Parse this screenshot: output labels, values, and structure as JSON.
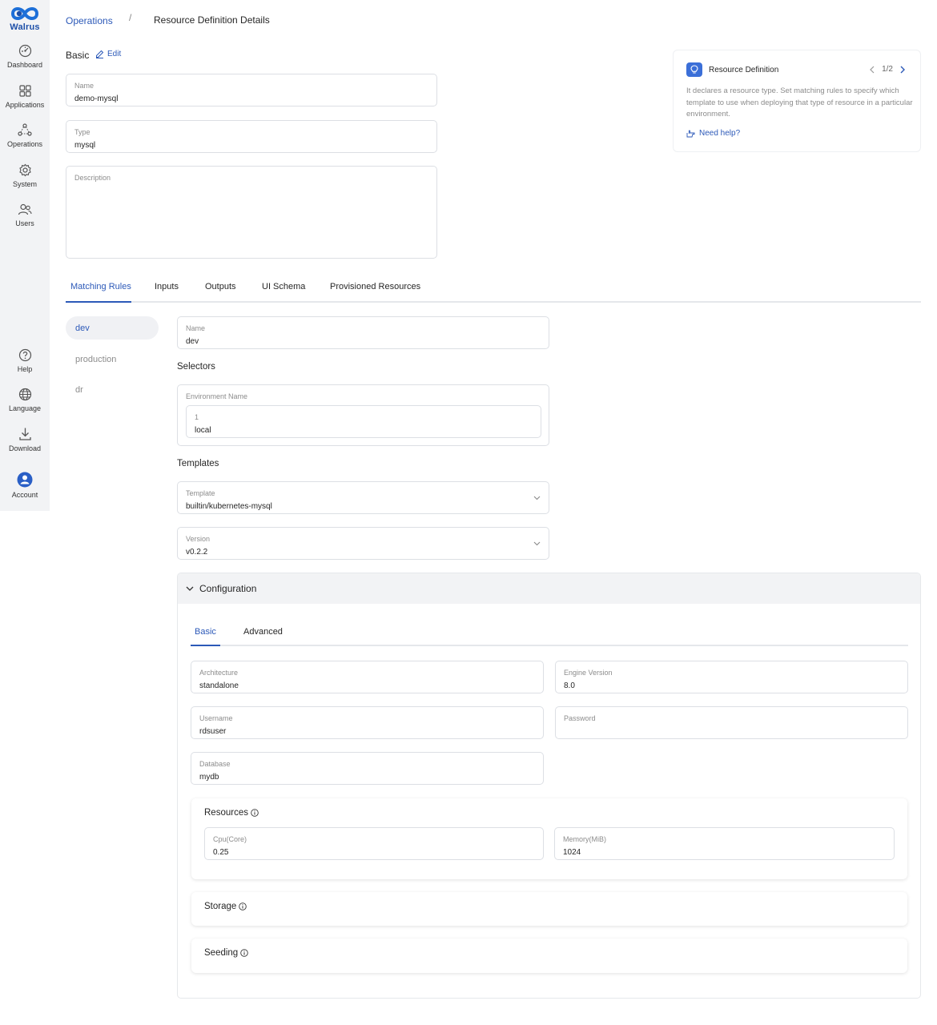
{
  "app": {
    "logo_text": "Walrus"
  },
  "sidebar": {
    "items": [
      {
        "label": "Dashboard",
        "icon": "dashboard-icon"
      },
      {
        "label": "Applications",
        "icon": "grid-icon"
      },
      {
        "label": "Operations",
        "icon": "operations-icon"
      },
      {
        "label": "System",
        "icon": "gear-icon"
      },
      {
        "label": "Users",
        "icon": "users-icon"
      }
    ],
    "bottom_items": [
      {
        "label": "Help",
        "icon": "help-icon"
      },
      {
        "label": "Language",
        "icon": "globe-icon"
      },
      {
        "label": "Download",
        "icon": "download-icon"
      },
      {
        "label": "Account",
        "icon": "account-icon"
      }
    ]
  },
  "breadcrumb": {
    "parent": "Operations",
    "separator": "/",
    "current": "Resource Definition Details"
  },
  "basic": {
    "title": "Basic",
    "edit_label": "Edit",
    "name": {
      "label": "Name",
      "value": "demo-mysql"
    },
    "type": {
      "label": "Type",
      "value": "mysql"
    },
    "description": {
      "label": "Description",
      "value": ""
    }
  },
  "tip": {
    "title": "Resource Definition",
    "pager": "1/2",
    "body": "It declares a resource type. Set matching rules to specify which template to use when deploying that type of resource in a particular environment.",
    "help_label": "Need help?"
  },
  "tabs": [
    "Matching Rules",
    "Inputs",
    "Outputs",
    "UI Schema",
    "Provisioned Resources"
  ],
  "rules": [
    "dev",
    "production",
    "dr"
  ],
  "rule_detail": {
    "name": {
      "label": "Name",
      "value": "dev"
    },
    "selectors_heading": "Selectors",
    "env_selector": {
      "label": "Environment Name",
      "index": "1",
      "value": "local"
    },
    "templates_heading": "Templates",
    "template": {
      "label": "Template",
      "value": "builtin/kubernetes-mysql"
    },
    "version": {
      "label": "Version",
      "value": "v0.2.2"
    }
  },
  "configuration": {
    "title": "Configuration",
    "tabs": [
      "Basic",
      "Advanced"
    ],
    "architecture": {
      "label": "Architecture",
      "value": "standalone"
    },
    "engine_version": {
      "label": "Engine Version",
      "value": "8.0"
    },
    "username": {
      "label": "Username",
      "value": "rdsuser"
    },
    "password": {
      "label": "Password",
      "value": ""
    },
    "database": {
      "label": "Database",
      "value": "mydb"
    },
    "resources": {
      "title": "Resources",
      "cpu": {
        "label": "Cpu(Core)",
        "value": "0.25"
      },
      "memory": {
        "label": "Memory(MiB)",
        "value": "1024"
      }
    },
    "storage": {
      "title": "Storage"
    },
    "seeding": {
      "title": "Seeding"
    }
  },
  "colors": {
    "accent": "#2c59b8",
    "sidebar_bg": "#f2f3f5",
    "tip_icon_bg": "#3b6fd8"
  }
}
